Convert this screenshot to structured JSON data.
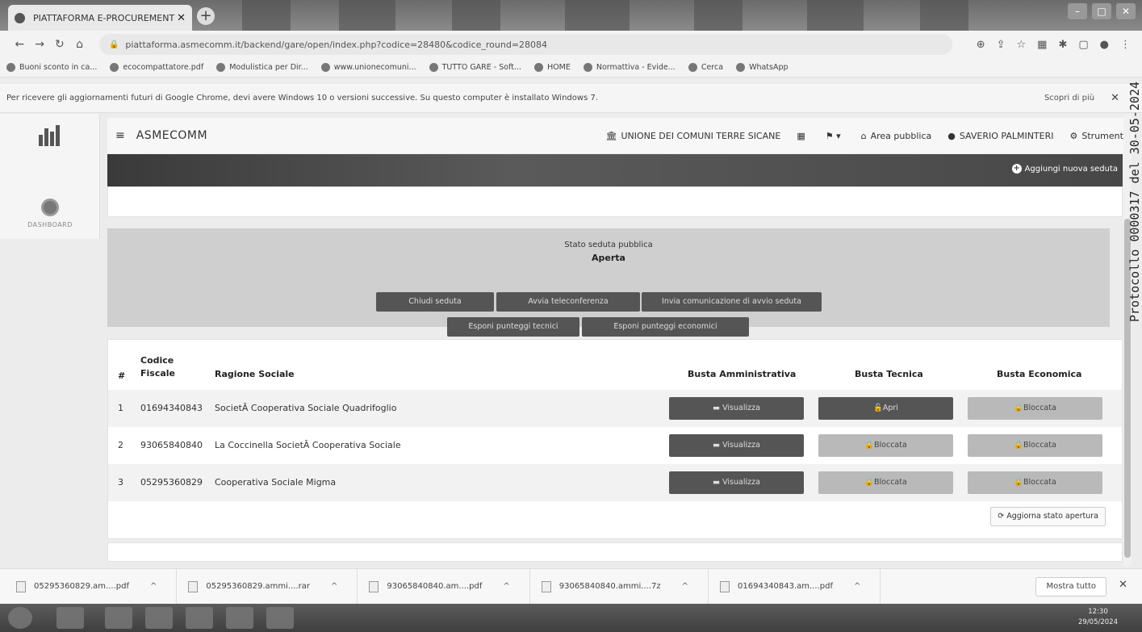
{
  "browser": {
    "tab_title": "PIATTAFORMA E-PROCUREMENT",
    "tab_close": "✕",
    "new_tab": "+",
    "url": "piattaforma.asmecomm.it/backend/gare/open/index.php?codice=28480&codice_round=28084",
    "bookmarks": [
      "Buoni sconto in ca...",
      "ecocompattatore.pdf",
      "Modulistica per Dir...",
      "www.unionecomuni...",
      "TUTTO GARE - Soft...",
      "HOME",
      "Normattiva - Evide...",
      "Cerca",
      "WhatsApp"
    ],
    "infobar_message": "Per ricevere gli aggiornamenti futuri di Google Chrome, devi avere Windows 10 o versioni successive. Su questo computer è installato Windows 7.",
    "infobar_link": "Scopri di più",
    "infobar_close": "✕"
  },
  "sidebar": {
    "dashboard_label": "DASHBOARD"
  },
  "header": {
    "brand": "ASMECOMM",
    "org": "UNIONE DEI COMUNI TERRE SICANE",
    "area_pubblica": "Area pubblica",
    "user": "SAVERIO PALMINTERI",
    "strumenti": "Strumenti"
  },
  "banner": {
    "add_label": "Aggiungi nuova seduta"
  },
  "stato": {
    "title": "Stato seduta pubblica",
    "value": "Aperta",
    "buttons": [
      "Chiudi seduta",
      "Avvia teleconferenza",
      "Invia comunicazione di avvio seduta",
      "Esponi punteggi tecnici",
      "Esponi punteggi economici"
    ]
  },
  "table": {
    "headers": {
      "num": "#",
      "codice": "Codice Fiscale",
      "ragione": "Ragione Sociale",
      "amm": "Busta Amministrativa",
      "tec": "Busta Tecnica",
      "eco": "Busta Economica"
    },
    "rows": [
      {
        "n": "1",
        "cf": "01694340843",
        "rs": "SocietÃ  Cooperativa Sociale Quadrifoglio",
        "amm": "Visualizza",
        "tec": "Apri",
        "eco": "Bloccata"
      },
      {
        "n": "2",
        "cf": "93065840840",
        "rs": "La Coccinella SocietÃ  Cooperativa Sociale",
        "amm": "Visualizza",
        "tec": "Bloccata",
        "eco": "Bloccata"
      },
      {
        "n": "3",
        "cf": "05295360829",
        "rs": "Cooperativa Sociale Migma",
        "amm": "Visualizza",
        "tec": "Bloccata",
        "eco": "Bloccata"
      }
    ],
    "refresh_label": "Aggiorna stato apertura"
  },
  "downloads": {
    "items": [
      "05295360829.am....pdf",
      "05295360829.ammi....rar",
      "93065840840.am....pdf",
      "93065840840.ammi....7z",
      "01694340843.am....pdf"
    ],
    "show_all": "Mostra tutto",
    "close": "✕"
  },
  "taskbar": {
    "time": "12:30",
    "date": "29/05/2024"
  },
  "stamp": "Protocollo 0000317 del 30-05-2024"
}
